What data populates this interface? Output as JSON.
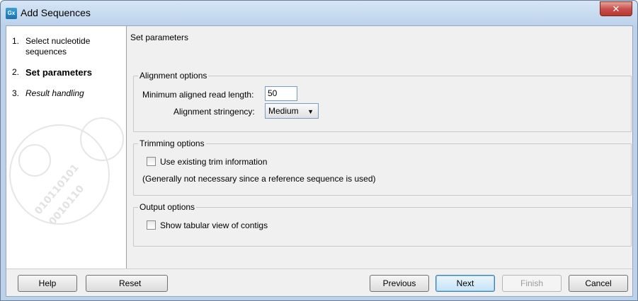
{
  "window": {
    "title": "Add Sequences",
    "app_icon_text": "Gx"
  },
  "steps": [
    {
      "num": "1.",
      "label": "Select nucleotide sequences"
    },
    {
      "num": "2.",
      "label": "Set parameters"
    },
    {
      "num": "3.",
      "label": "Result handling"
    }
  ],
  "main": {
    "section_title": "Set parameters",
    "alignment": {
      "title": "Alignment options",
      "min_read_label": "Minimum aligned read length:",
      "min_read_value": "50",
      "stringency_label": "Alignment stringency:",
      "stringency_value": "Medium"
    },
    "trimming": {
      "title": "Trimming options",
      "use_trim_label": "Use existing trim information",
      "note": "(Generally not necessary since a reference sequence is used)"
    },
    "output": {
      "title": "Output options",
      "tabular_label": "Show tabular view of contigs"
    }
  },
  "buttons": {
    "help": "Help",
    "reset": "Reset",
    "previous": "Previous",
    "next": "Next",
    "finish": "Finish",
    "cancel": "Cancel"
  },
  "icons": {
    "close": "close-icon",
    "dropdown": "chevron-down-icon",
    "app": "app-icon"
  }
}
